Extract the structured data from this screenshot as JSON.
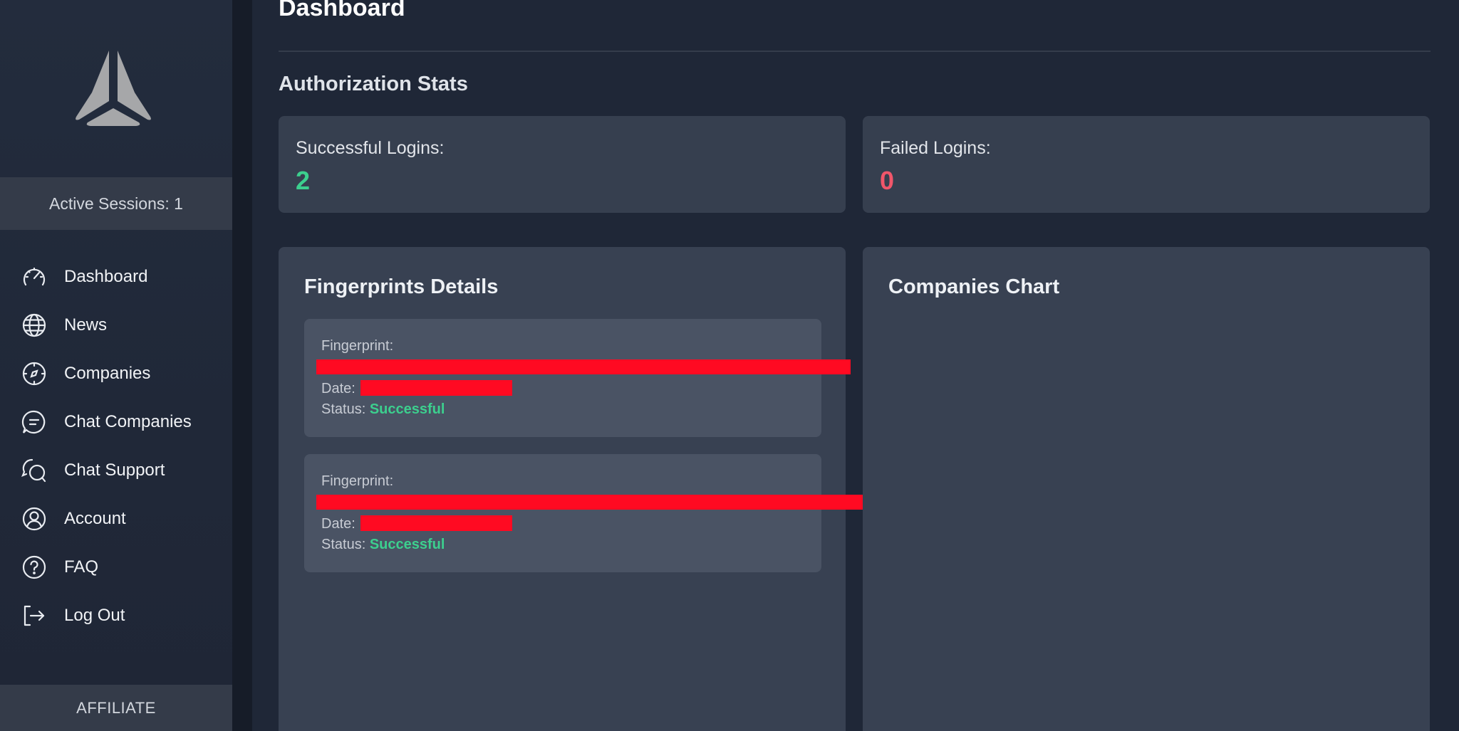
{
  "sidebar": {
    "active_sessions": "Active Sessions: 1",
    "items": [
      {
        "label": "Dashboard",
        "icon": "speedometer-icon"
      },
      {
        "label": "News",
        "icon": "globe-icon"
      },
      {
        "label": "Companies",
        "icon": "compass-icon"
      },
      {
        "label": "Chat Companies",
        "icon": "chat-bubble-icon"
      },
      {
        "label": "Chat Support",
        "icon": "support-chat-icon"
      },
      {
        "label": "Account",
        "icon": "user-circle-icon"
      },
      {
        "label": "FAQ",
        "icon": "question-circle-icon"
      },
      {
        "label": "Log Out",
        "icon": "logout-icon"
      }
    ],
    "affiliate_label": "AFFILIATE"
  },
  "main": {
    "title": "Dashboard",
    "auth_section_title": "Authorization Stats",
    "successful_logins": {
      "label": "Successful Logins:",
      "value": "2",
      "color": "#3ccf8e"
    },
    "failed_logins": {
      "label": "Failed Logins:",
      "value": "0",
      "color": "#f0566a"
    },
    "fingerprints": {
      "title": "Fingerprints Details",
      "entries": [
        {
          "fingerprint_label": "Fingerprint:",
          "date_label": "Date:",
          "status_label": "Status:",
          "status_value": "Successful"
        },
        {
          "fingerprint_label": "Fingerprint:",
          "date_label": "Date:",
          "status_label": "Status:",
          "status_value": "Successful"
        }
      ]
    },
    "companies_chart": {
      "title": "Companies Chart"
    }
  },
  "colors": {
    "success": "#3ccf8e",
    "danger": "#f0566a",
    "redaction": "#ff0a22"
  }
}
